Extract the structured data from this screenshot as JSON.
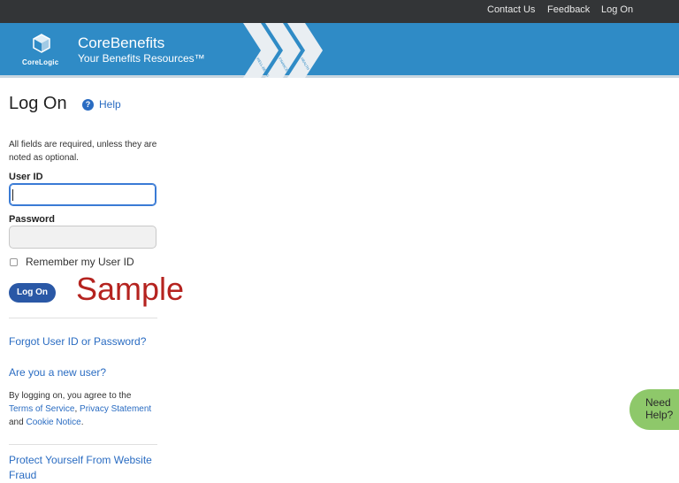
{
  "topnav": {
    "contact": "Contact Us",
    "feedback": "Feedback",
    "logon": "Log On"
  },
  "banner": {
    "logo_text": "CoreLogic",
    "brand": "CoreBenefits",
    "tagline": "Your Benefits Resources™",
    "chevrons": [
      "WELL-BEING",
      "FINANCE",
      "HEALTH"
    ],
    "color": "#2f8bc6"
  },
  "page": {
    "title": "Log On",
    "help_icon": "?",
    "help": "Help",
    "required_note": "All fields are required, unless they are noted as optional."
  },
  "form": {
    "userid_label": "User ID",
    "userid_value": "",
    "password_label": "Password",
    "password_value": "",
    "remember_label": "Remember my User ID",
    "remember_checked": false,
    "submit": "Log On",
    "button_color": "#2a58a6"
  },
  "watermark": "Sample",
  "links": {
    "forgot": "Forgot User ID or Password?",
    "new_user": "Are you a new user?",
    "agree_prefix": "By logging on, you agree to the",
    "terms": "Terms of Service",
    "comma": ",",
    "privacy": "Privacy Statement",
    "and": "and",
    "cookie": "Cookie Notice",
    "period": ".",
    "protect": "Protect Yourself From Website Fraud"
  },
  "chat": {
    "need_help": "Need Help?",
    "color": "#8ec86a"
  }
}
